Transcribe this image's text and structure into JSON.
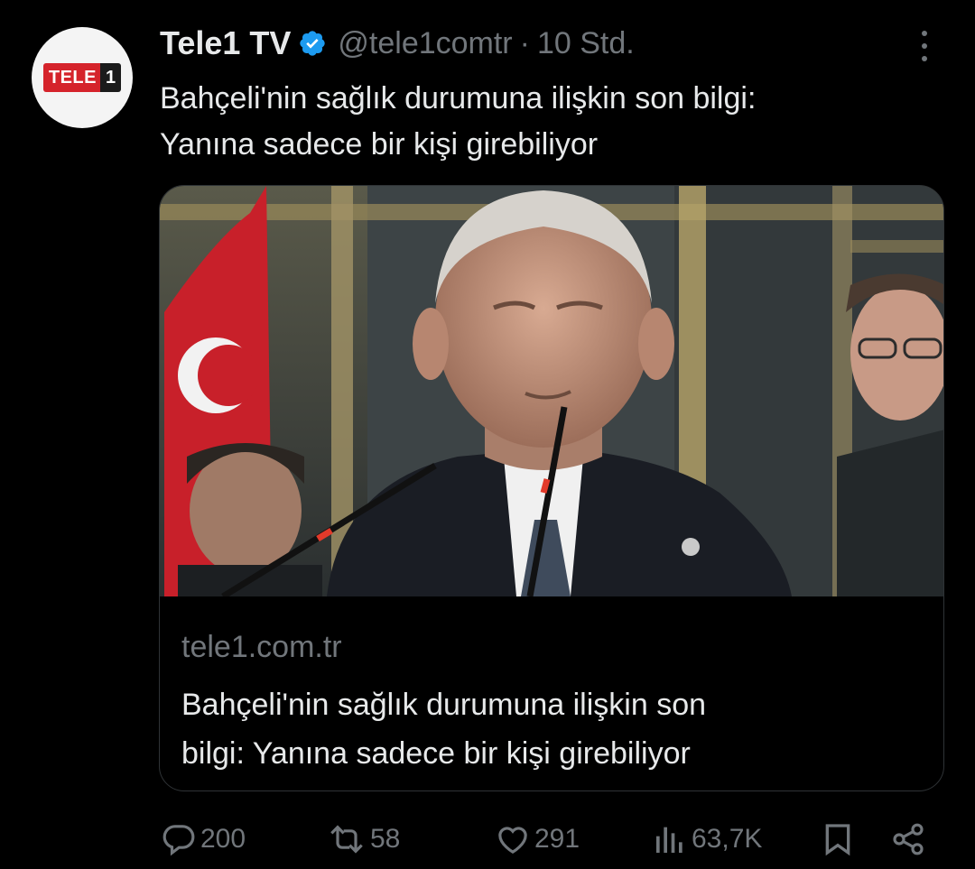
{
  "tweet": {
    "author": {
      "name": "Tele1 TV",
      "handle": "@tele1comtr",
      "separator": "·",
      "time": "10 Std.",
      "avatar_logo": {
        "main": "TELE",
        "number": "1"
      },
      "verified_icon": "verified-badge-icon"
    },
    "text_line1": "Bahçeli'nin sağlık durumuna ilişkin son bilgi:",
    "text_line2": "Yanına sadece bir kişi girebiliyor",
    "card": {
      "domain": "tele1.com.tr",
      "title_line1": "Bahçeli'nin sağlık durumuna ilişkin son",
      "title_line2": "bilgi: Yanına sadece bir kişi girebiliyor"
    },
    "actions": {
      "replies": "200",
      "reposts": "58",
      "likes": "291",
      "views": "63,7K"
    }
  },
  "colors": {
    "background": "#000000",
    "text": "#e7e9ea",
    "muted": "#71767b",
    "verified": "#1d9bf0",
    "brand_red": "#d5232b"
  }
}
